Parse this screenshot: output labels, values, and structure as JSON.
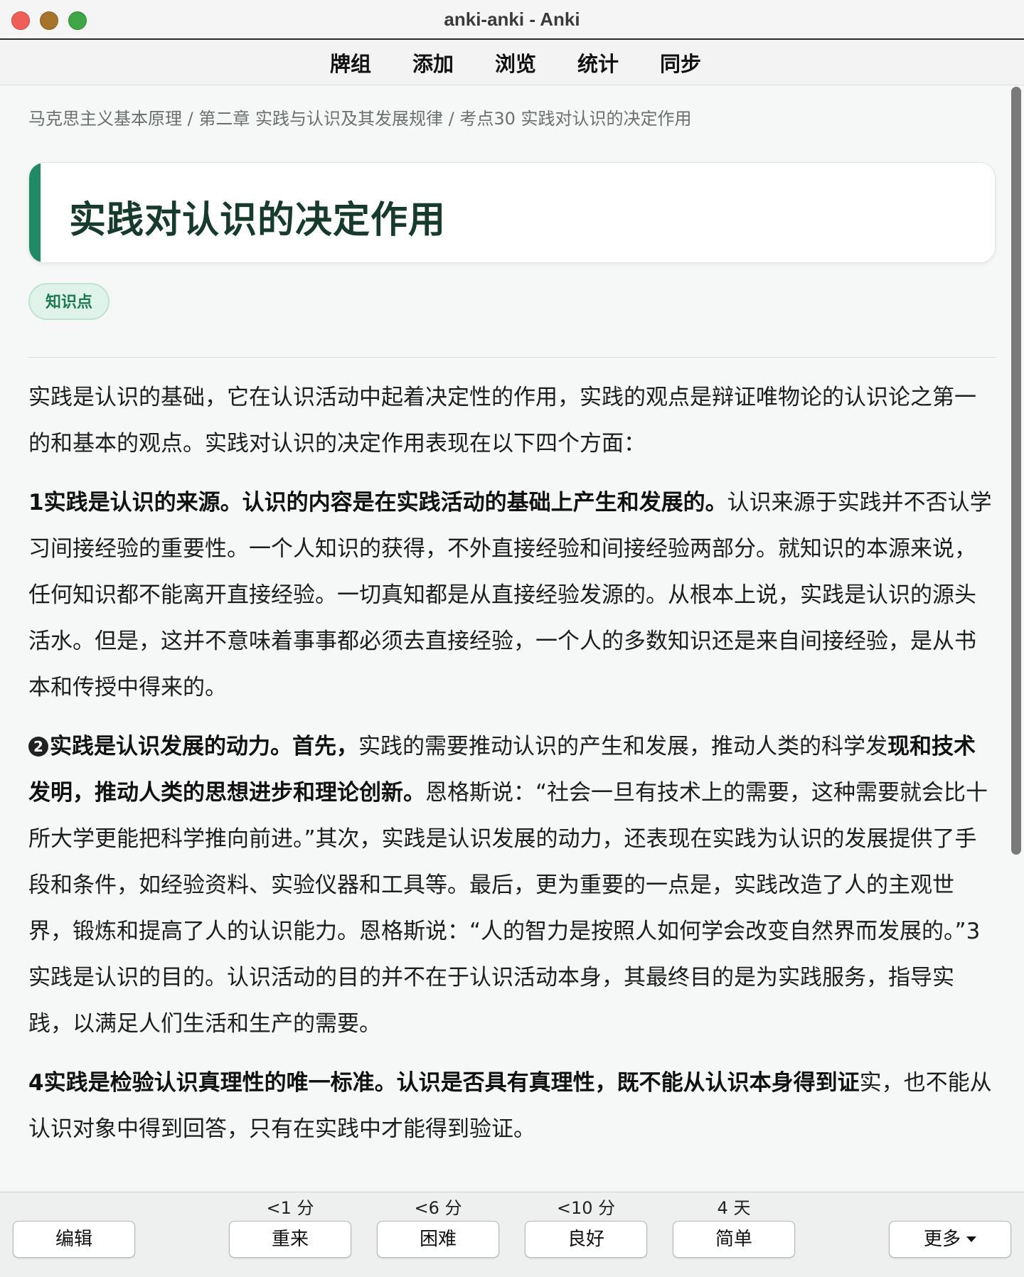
{
  "window": {
    "title": "anki-anki - Anki"
  },
  "nav": {
    "items": [
      "牌组",
      "添加",
      "浏览",
      "统计",
      "同步"
    ]
  },
  "card": {
    "breadcrumb": "马克思主义基本原理 / 第二章 实践与认识及其发展规律 / 考点30 实践对认识的决定作用",
    "title": "实践对认识的决定作用",
    "tag": "知识点",
    "intro": "实践是认识的基础，它在认识活动中起着决定性的作用，实践的观点是辩证唯物论的认识论之第一的和基本的观点。实践对认识的决定作用表现在以下四个方面：",
    "p1_bold": "1实践是认识的来源。认识的内容是在实践活动的基础上产生和发展的。",
    "p1_rest": "认识来源于实践并不否认学习间接经验的重要性。一个人知识的获得，不外直接经验和间接经验两部分。就知识的本源来说，任何知识都不能离开直接经验。一切真知都是从直接经验发源的。从根本上说，实践是认识的源头活水。但是，这并不意味着事事都必须去直接经验，一个人的多数知识还是来自间接经验，是从书本和传授中得来的。",
    "p2_num": "2",
    "p2_bold1": "实践是认识发展的动力。首先，",
    "p2_mid": "实践的需要推动认识的产生和发展，推动人类的科学发",
    "p2_bold2": "现和技术发明，推动人类的思想进步和理论创新。",
    "p2_rest": "恩格斯说：“社会一旦有技术上的需要，这种需要就会比十所大学更能把科学推向前进。”其次，实践是认识发展的动力，还表现在实践为认识的发展提供了手段和条件，如经验资料、实验仪器和工具等。最后，更为重要的一点是，实践改造了人的主观世界，锻炼和提高了人的认识能力。恩格斯说：“人的智力是按照人如何学会改变自然界而发展的。”3实践是认识的目的。认识活动的目的并不在于认识活动本身，其最终目的是为实践服务，指导实践，以满足人们生活和生产的需要。",
    "p4_bold": "4实践是检验认识真理性的唯一标准。认识是否具有真理性，既不能从认识本身得到证",
    "p4_rest": "实，也不能从认识对象中得到回答，只有在实践中才能得到验证。"
  },
  "bottom": {
    "edit": "编辑",
    "more": "更多",
    "answers": [
      {
        "label": "重来",
        "due": "<1 分"
      },
      {
        "label": "困难",
        "due": "<6 分"
      },
      {
        "label": "良好",
        "due": "<10 分"
      },
      {
        "label": "简单",
        "due": "4 天"
      }
    ]
  }
}
